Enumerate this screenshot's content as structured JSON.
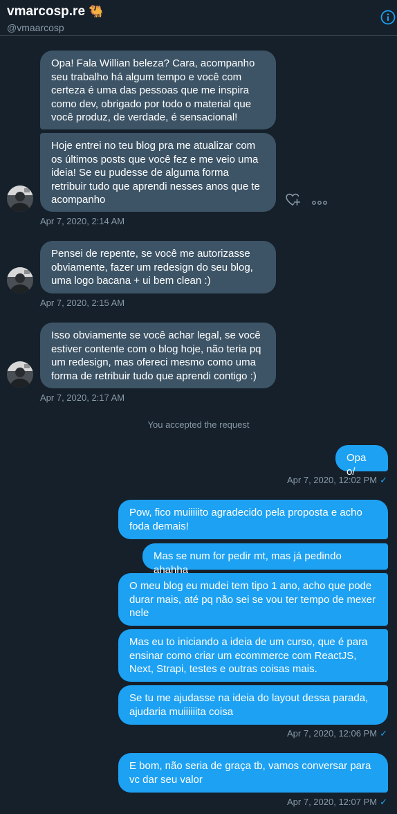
{
  "header": {
    "name": "vmarcosp.re",
    "emoji": "🐫",
    "handle": "@vmaarcosp"
  },
  "incoming": [
    "Opa! Fala Willian beleza? Cara, acompanho seu trabalho há algum tempo e você com certeza é uma das pessoas que me inspira como dev, obrigado por todo o material que você produz, de verdade, é sensacional!",
    "Hoje entrei no teu blog pra me atualizar com os últimos posts que você fez e me veio uma ideia! Se eu pudesse de alguma forma retribuir tudo que aprendi nesses anos que te acompanho",
    "Pensei de repente, se você me autorizasse obviamente, fazer um redesign do seu blog, uma logo bacana + ui bem clean :)",
    "Isso obviamente se você achar legal, se você estiver contente com o blog hoje, não teria pq um redesign, mas ofereci mesmo como uma forma de retribuir tudo que aprendi contigo :)"
  ],
  "incoming_times": [
    "Apr 7, 2020, 2:14 AM",
    "Apr 7, 2020, 2:15 AM",
    "Apr 7, 2020, 2:17 AM"
  ],
  "system_message": "You accepted the request",
  "outgoing": [
    "Opa o/",
    "Pow, fico muiiiiito agradecido pela proposta e acho foda demais!",
    "Mas se num for pedir mt, mas já pedindo ahahha",
    "O meu blog eu mudei tem tipo 1 ano, acho que pode durar mais, até pq não sei se vou ter tempo de mexer nele",
    "Mas eu to iniciando a ideia de um curso, que é para ensinar como criar um ecommerce com ReactJS, Next, Strapi, testes e outras coisas mais.",
    "Se tu me ajudasse na ideia do layout dessa parada, ajudaria muiiiiiita coisa",
    "E bom, não seria de graça tb, vamos conversar para vc dar seu valor"
  ],
  "outgoing_times": [
    "Apr 7, 2020, 12:02 PM",
    "Apr 7, 2020, 12:06 PM",
    "Apr 7, 2020, 12:07 PM"
  ],
  "colors": {
    "background": "#15202b",
    "incoming_bubble": "#3d5466",
    "outgoing_bubble": "#1da1f2",
    "muted_text": "#8899a6",
    "divider": "#38444d"
  },
  "icons": [
    "info-icon",
    "heart-add-icon",
    "more-icon",
    "read-check-icon",
    "avatar"
  ]
}
